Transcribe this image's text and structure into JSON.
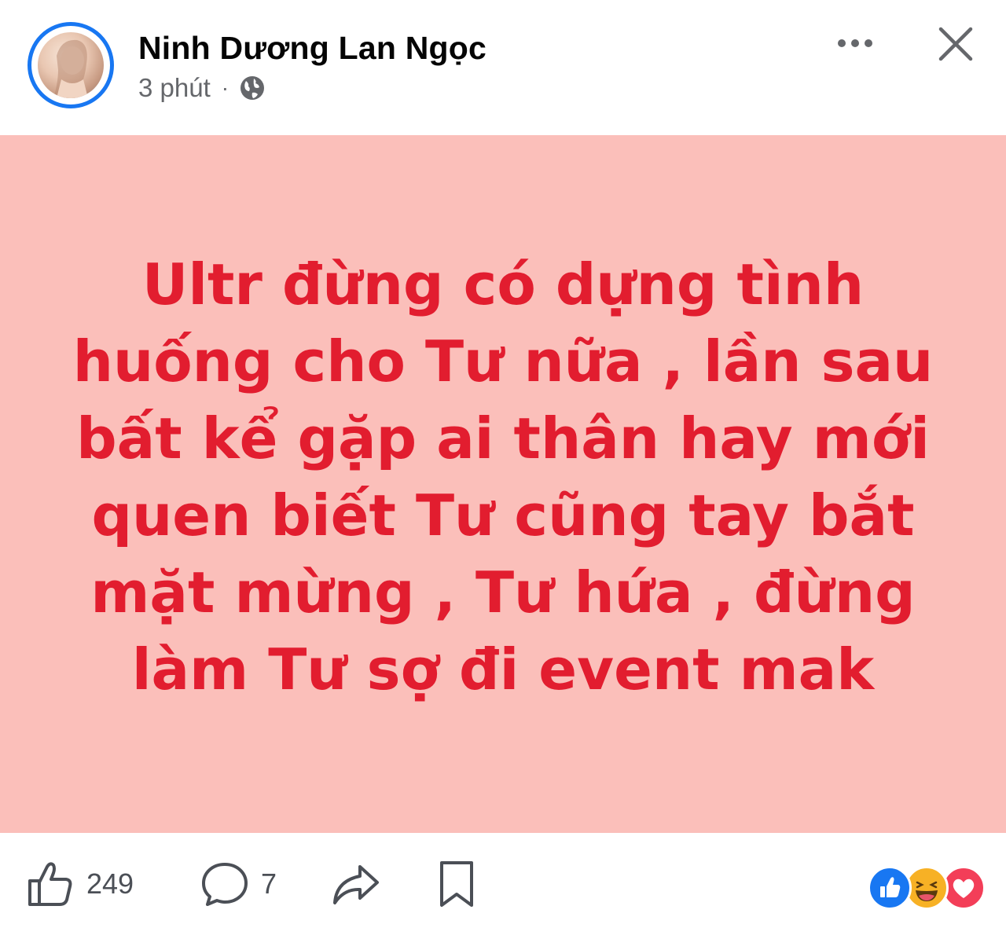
{
  "author": {
    "name": "Ninh Dương Lan Ngọc",
    "time": "3 phút",
    "separator": "·",
    "privacy_icon": "globe-icon"
  },
  "header_actions": {
    "more_icon": "more-options-icon",
    "close_icon": "close-icon"
  },
  "post": {
    "background_color": "#fbbfba",
    "text_color": "#e21d2f",
    "lines": [
      "Ultr đừng có dựng tình",
      "huống cho Tư nữa , lần sau",
      "bất kể gặp ai thân hay mới",
      "quen biết Tư cũng tay bắt",
      "mặt mừng , Tư hứa , đừng",
      "làm Tư sợ đi event mak"
    ]
  },
  "footer": {
    "like_icon": "thumbs-up-icon",
    "like_count": "249",
    "comment_icon": "comment-bubble-icon",
    "comment_count": "7",
    "share_icon": "share-arrow-icon",
    "save_icon": "bookmark-icon",
    "reactions": [
      "like-reaction-icon",
      "haha-reaction-icon",
      "love-reaction-icon"
    ]
  },
  "colors": {
    "accent": "#1877f2",
    "love": "#f33e58",
    "haha": "#f7b125"
  }
}
